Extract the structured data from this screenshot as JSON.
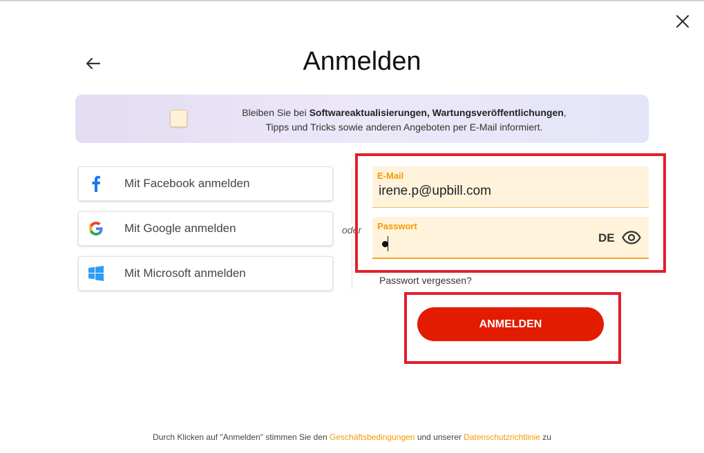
{
  "window": {
    "title": "Anmelden"
  },
  "newsletter": {
    "text_prefix": "Bleiben Sie bei ",
    "text_bold": "Softwareaktualisierungen, Wartungsveröffentlichungen",
    "text_comma": ",",
    "text_line2": "Tipps und Tricks sowie anderen Angeboten per E-Mail informiert.",
    "checked": false
  },
  "social": {
    "facebook_label": "Mit Facebook anmelden",
    "google_label": "Mit Google anmelden",
    "microsoft_label": "Mit Microsoft anmelden"
  },
  "separator": {
    "or_label": "oder"
  },
  "form": {
    "email_label": "E-Mail",
    "email_value": "irene.p@upbill.com",
    "password_label": "Passwort",
    "password_lang": "DE",
    "forgot_label": "Passwort vergessen?",
    "submit_label": "ANMELDEN"
  },
  "footer": {
    "prefix": "Durch Klicken auf \"Anmelden\" stimmen Sie den ",
    "terms_link": "Geschäftsbedingungen",
    "middle": " und unserer ",
    "privacy_link": "Datenschutzrichtlinie",
    "suffix": " zu"
  },
  "colors": {
    "accent": "#f59b00",
    "primary_button": "#e31b00",
    "highlight_border": "#e41e2b",
    "field_bg": "#fff3dc",
    "facebook_blue": "#1877f2",
    "microsoft_blue": "#2f9cf0"
  },
  "icons": {
    "close": "close-icon",
    "back": "arrow-left-icon",
    "facebook": "facebook-icon",
    "google": "google-icon",
    "microsoft": "windows-icon",
    "eye": "eye-icon"
  }
}
